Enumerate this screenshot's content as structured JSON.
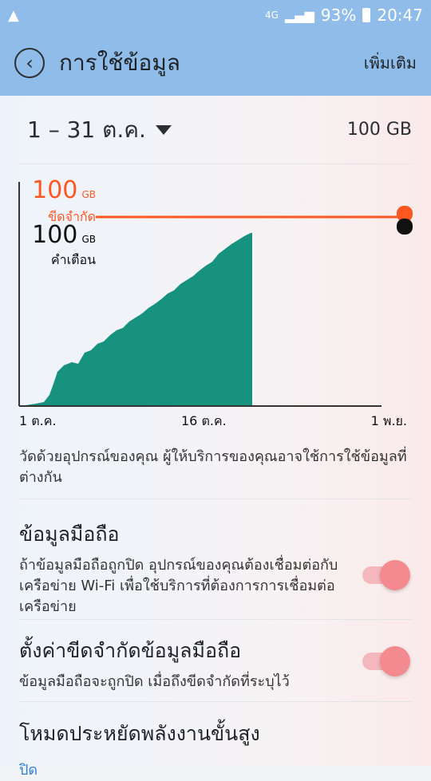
{
  "status": {
    "alert_icon": "warning-triangle-icon",
    "net": "4G",
    "battery": "93%",
    "time": "20:47"
  },
  "app": {
    "title": "การใช้ข้อมูล",
    "more_label": "เพิ่มเติม"
  },
  "date_range": {
    "label": "1 – 31 ต.ค.",
    "quota": "100 GB"
  },
  "chart_data": {
    "type": "area",
    "x_ticks": [
      "1 ต.ค.",
      "16 ต.ค.",
      "1 พ.ย."
    ],
    "limit": {
      "value": "100",
      "unit": "GB",
      "label": "ขีดจำกัด",
      "color": "#ff5722"
    },
    "warning": {
      "value": "100",
      "unit": "GB",
      "label": "คำเตือน",
      "color": "#111111"
    },
    "fill_color": "#17927f"
  },
  "note": "วัดด้วยอุปกรณ์ของคุณ ผู้ให้บริการของคุณอาจใช้การใช้ข้อมูลที่ต่างกัน",
  "mobile_data": {
    "title": "ข้อมูลมือถือ",
    "desc": "ถ้าข้อมูลมือถือถูกปิด อุปกรณ์ของคุณต้องเชื่อมต่อกับเครือข่าย Wi-Fi เพื่อใช้บริการที่ต้องการการเชื่อมต่อเครือข่าย",
    "enabled": true
  },
  "limit_setting": {
    "title": "ตั้งค่าขีดจำกัดข้อมูลมือถือ",
    "desc": "ข้อมูลมือถือจะถูกปิด เมื่อถึงขีดจำกัดที่ระบุไว้",
    "enabled": true
  },
  "power_saving": {
    "title": "โหมดประหยัดพลังงานขั้นสูง",
    "value": "ปิด"
  }
}
